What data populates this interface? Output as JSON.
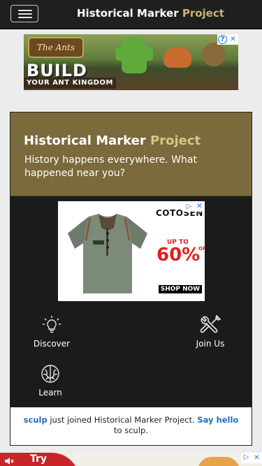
{
  "navbar": {
    "brand_main": "Historical Marker",
    "brand_accent": "Project"
  },
  "top_ad": {
    "logo_text": "The Ants",
    "headline": "BUILD",
    "subline": "YOUR ANT KINGDOM",
    "info_icon": "info-icon",
    "close_icon": "close-icon"
  },
  "hero": {
    "title_main": "Historical Marker",
    "title_accent": "Project",
    "tagline": "History happens everywhere. What happened near you?"
  },
  "middle_ad": {
    "brand": "COTOSEN",
    "up_to": "UP TO",
    "percent": "60%",
    "off": "OFF",
    "cta": "SHOP NOW",
    "info_icon": "play-triangle-icon",
    "close_icon": "close-icon"
  },
  "features": [
    {
      "label": "Discover",
      "icon": "lightbulb-icon"
    },
    {
      "label": "Join Us",
      "icon": "tools-icon"
    },
    {
      "label": "Learn",
      "icon": "brain-icon"
    }
  ],
  "activity": {
    "user": "sculp",
    "text1": "just joined Historical Marker Project.",
    "cta": "Say hello",
    "text2": "to sculp."
  },
  "bottom_ad": {
    "label": "Try",
    "mute_icon": "mute-icon"
  },
  "colors": {
    "navbar_bg": "#1f1f1f",
    "accent_gold": "#c8b46a",
    "hero_bg": "#7a6a3c",
    "card_bg": "#1b1b1b",
    "link_blue": "#1f6fb8"
  }
}
